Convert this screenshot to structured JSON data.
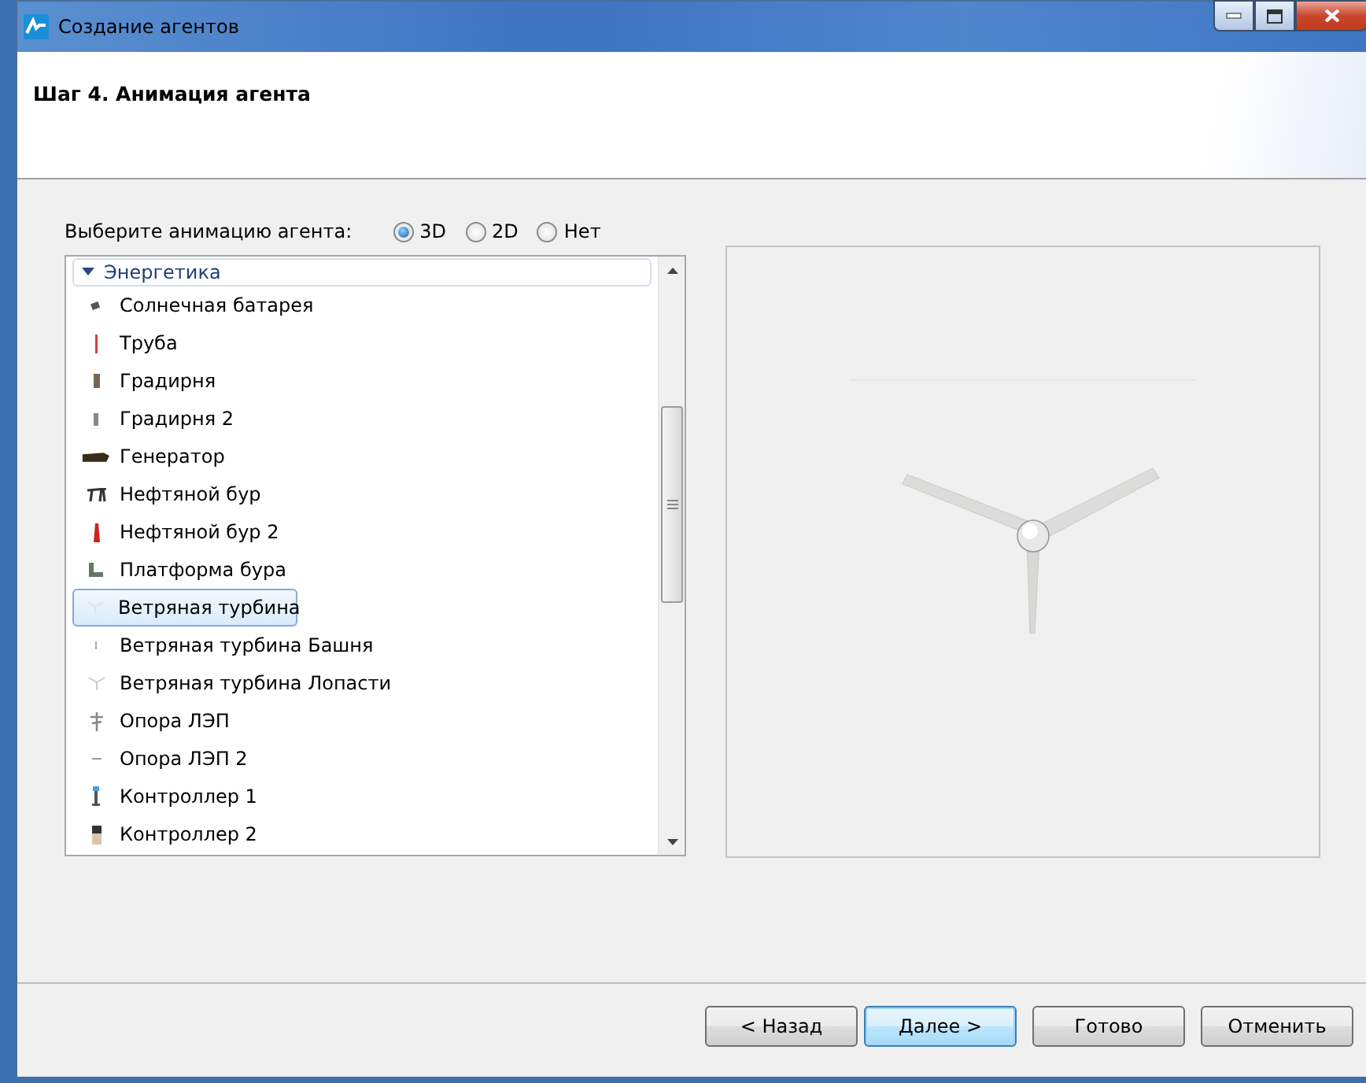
{
  "window": {
    "title": "Создание агентов"
  },
  "step_title": "Шаг 4. Анимация агента",
  "animation": {
    "label": "Выберите анимацию агента:",
    "options": [
      {
        "label": "3D",
        "selected": true
      },
      {
        "label": "2D",
        "selected": false
      },
      {
        "label": "Нет",
        "selected": false
      }
    ]
  },
  "tree": {
    "label": "Энергетика",
    "expanded": true,
    "children": [
      {
        "label": "Солнечная батарея",
        "selected": false
      },
      {
        "label": "Труба",
        "selected": false
      },
      {
        "label": "Градирня",
        "selected": false
      },
      {
        "label": "Градирня 2",
        "selected": false
      },
      {
        "label": "Генератор",
        "selected": false
      },
      {
        "label": "Нефтяной бур",
        "selected": false
      },
      {
        "label": "Нефтяной бур 2",
        "selected": false
      },
      {
        "label": "Платформа бура",
        "selected": false
      },
      {
        "label": "Ветряная турбина",
        "selected": true
      },
      {
        "label": "Ветряная турбина Башня",
        "selected": false
      },
      {
        "label": "Ветряная турбина Лопасти",
        "selected": false
      },
      {
        "label": "Опора ЛЭП",
        "selected": false
      },
      {
        "label": "Опора ЛЭП 2",
        "selected": false
      },
      {
        "label": "Контроллер 1",
        "selected": false
      },
      {
        "label": "Контроллер 2",
        "selected": false
      }
    ]
  },
  "buttons": [
    {
      "label": "< Назад",
      "focused": false
    },
    {
      "label": "Далее >",
      "focused": true
    },
    {
      "label": "Готово",
      "focused": false
    },
    {
      "label": "Отменить",
      "focused": false
    }
  ]
}
